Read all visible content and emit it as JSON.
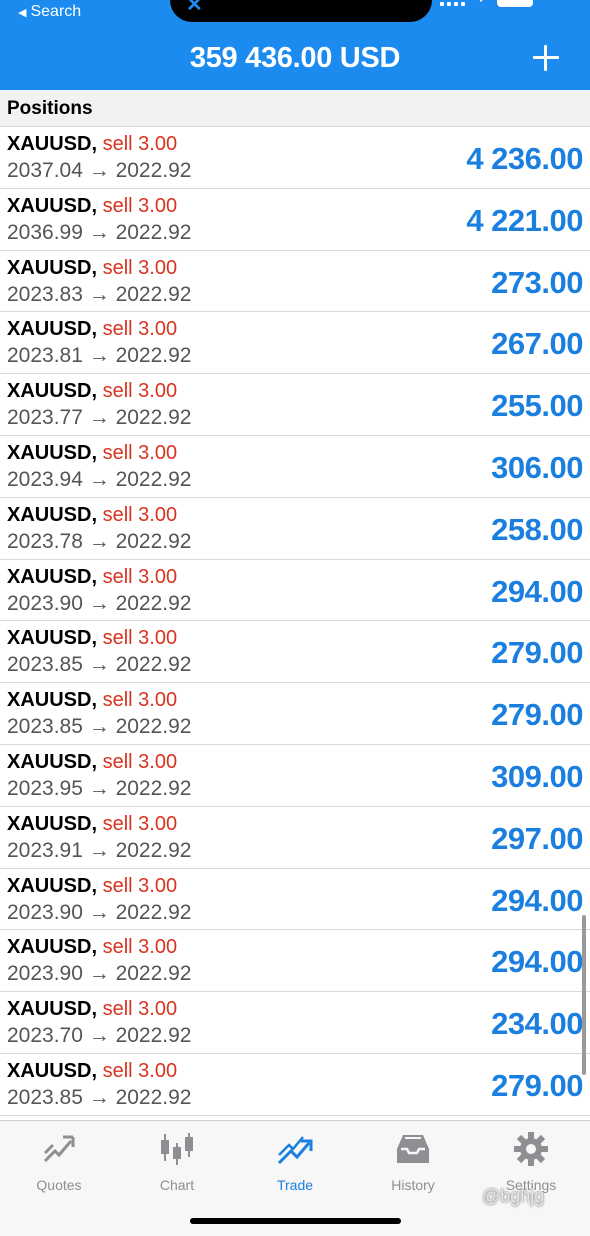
{
  "status_bar": {
    "back_label": "Search"
  },
  "header": {
    "balance": "359 436.00 USD"
  },
  "section": {
    "title": "Positions"
  },
  "positions": [
    {
      "symbol": "XAUUSD,",
      "side": "sell 3.00",
      "prices": "2037.04 → 2022.92",
      "profit": "4 236.00"
    },
    {
      "symbol": "XAUUSD,",
      "side": "sell 3.00",
      "prices": "2036.99 → 2022.92",
      "profit": "4 221.00"
    },
    {
      "symbol": "XAUUSD,",
      "side": "sell 3.00",
      "prices": "2023.83 → 2022.92",
      "profit": "273.00"
    },
    {
      "symbol": "XAUUSD,",
      "side": "sell 3.00",
      "prices": "2023.81 → 2022.92",
      "profit": "267.00"
    },
    {
      "symbol": "XAUUSD,",
      "side": "sell 3.00",
      "prices": "2023.77 → 2022.92",
      "profit": "255.00"
    },
    {
      "symbol": "XAUUSD,",
      "side": "sell 3.00",
      "prices": "2023.94 → 2022.92",
      "profit": "306.00"
    },
    {
      "symbol": "XAUUSD,",
      "side": "sell 3.00",
      "prices": "2023.78 → 2022.92",
      "profit": "258.00"
    },
    {
      "symbol": "XAUUSD,",
      "side": "sell 3.00",
      "prices": "2023.90 → 2022.92",
      "profit": "294.00"
    },
    {
      "symbol": "XAUUSD,",
      "side": "sell 3.00",
      "prices": "2023.85 → 2022.92",
      "profit": "279.00"
    },
    {
      "symbol": "XAUUSD,",
      "side": "sell 3.00",
      "prices": "2023.85 → 2022.92",
      "profit": "279.00"
    },
    {
      "symbol": "XAUUSD,",
      "side": "sell 3.00",
      "prices": "2023.95 → 2022.92",
      "profit": "309.00"
    },
    {
      "symbol": "XAUUSD,",
      "side": "sell 3.00",
      "prices": "2023.91 → 2022.92",
      "profit": "297.00"
    },
    {
      "symbol": "XAUUSD,",
      "side": "sell 3.00",
      "prices": "2023.90 → 2022.92",
      "profit": "294.00"
    },
    {
      "symbol": "XAUUSD,",
      "side": "sell 3.00",
      "prices": "2023.90 → 2022.92",
      "profit": "294.00"
    },
    {
      "symbol": "XAUUSD,",
      "side": "sell 3.00",
      "prices": "2023.70 → 2022.92",
      "profit": "234.00"
    },
    {
      "symbol": "XAUUSD,",
      "side": "sell 3.00",
      "prices": "2023.85 → 2022.92",
      "profit": "279.00"
    }
  ],
  "tabs": [
    {
      "label": "Quotes",
      "icon": "quotes-icon",
      "active": false
    },
    {
      "label": "Chart",
      "icon": "candlestick-icon",
      "active": false
    },
    {
      "label": "Trade",
      "icon": "trade-icon",
      "active": true
    },
    {
      "label": "History",
      "icon": "inbox-icon",
      "active": false
    },
    {
      "label": "Settings",
      "icon": "gear-icon",
      "active": false
    }
  ],
  "colors": {
    "header_blue": "#1b8bf0",
    "profit_blue": "#1b7fe0",
    "sell_red": "#d9331f",
    "tab_inactive": "#8e8e93"
  },
  "watermark": "@bghjg"
}
